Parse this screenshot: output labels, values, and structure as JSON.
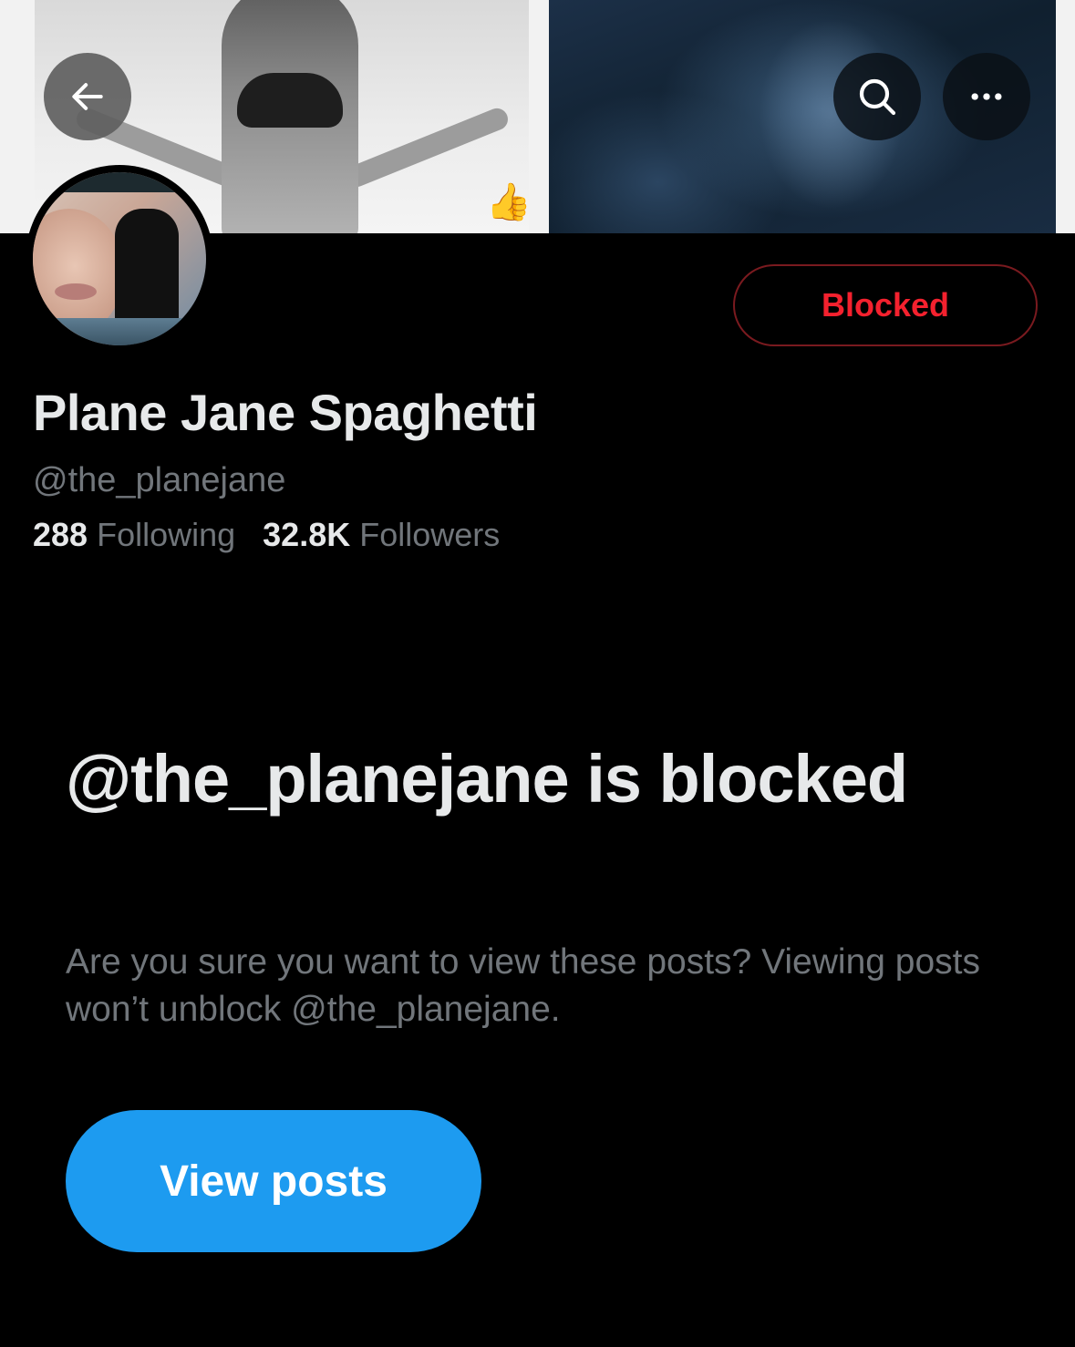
{
  "header": {
    "back_icon": "arrow-left-icon",
    "search_icon": "search-icon",
    "more_icon": "more-horizontal-icon"
  },
  "profile": {
    "display_name": "Plane Jane Spaghetti",
    "handle": "@the_planejane",
    "following_count": "288",
    "following_label": "Following",
    "followers_count": "32.8K",
    "followers_label": "Followers",
    "relationship_button": "Blocked"
  },
  "blocked_notice": {
    "title": "@the_planejane is blocked",
    "body": "Are you sure you want to view these posts? Viewing posts won’t unblock @the_planejane.",
    "view_posts_button": "View posts"
  },
  "colors": {
    "background": "#000000",
    "primary_text": "#e7e9ea",
    "secondary_text": "#71767b",
    "blocked_red": "#f4212e",
    "blocked_border": "#7a1a1f",
    "accent_blue": "#1d9bf0"
  }
}
